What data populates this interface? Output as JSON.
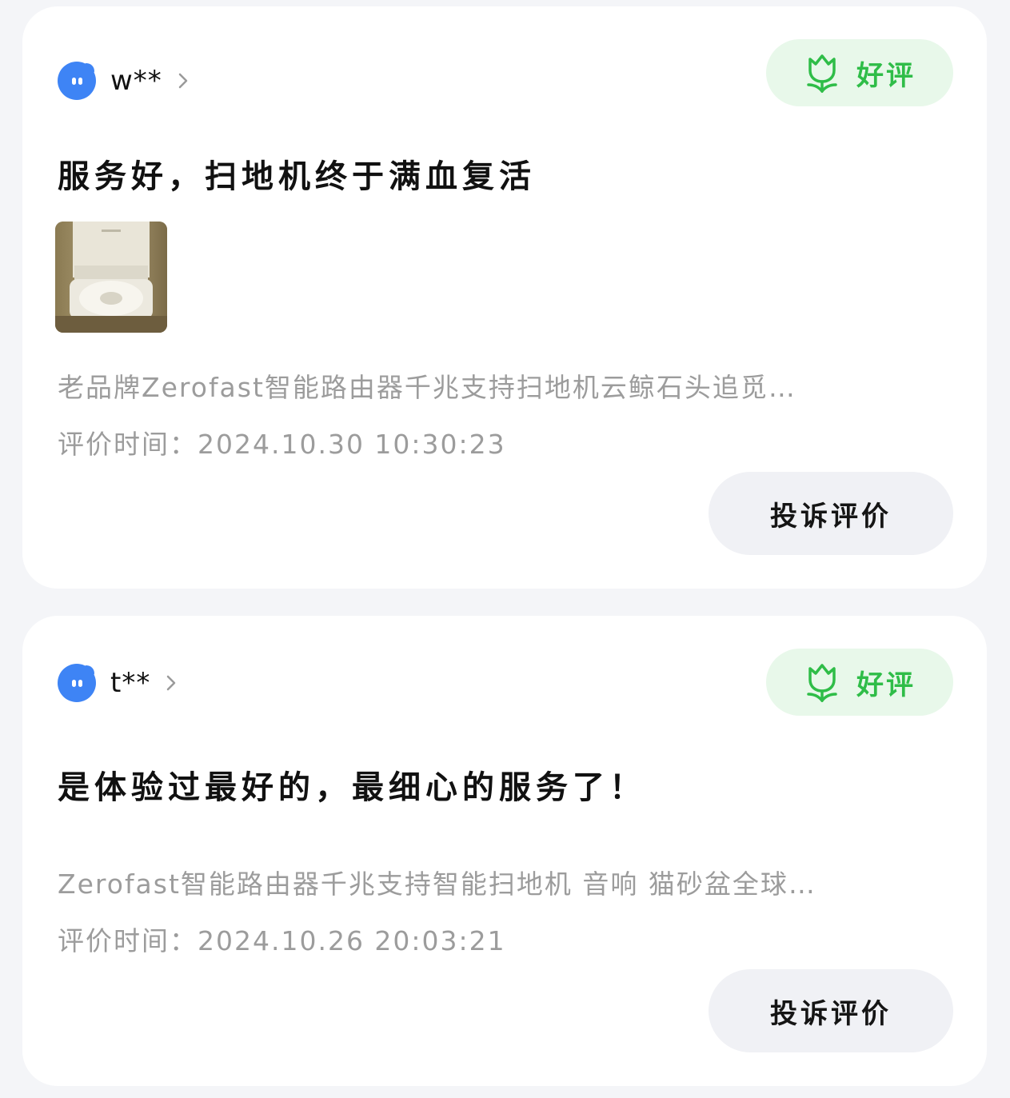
{
  "reviews": [
    {
      "username": "w**",
      "badge_label": "好评",
      "title": "服务好，扫地机终于满血复活",
      "has_photo": true,
      "product": "老品牌Zerofast智能路由器千兆支持扫地机云鲸石头追觅…",
      "time_prefix": "评价时间：",
      "time_value": "2024.10.30 10:30:23",
      "complain_label": "投诉评价"
    },
    {
      "username": "t**",
      "badge_label": "好评",
      "title": "是体验过最好的，最细心的服务了！",
      "has_photo": false,
      "product": "Zerofast智能路由器千兆支持智能扫地机 音响 猫砂盆全球…",
      "time_prefix": "评价时间：",
      "time_value": "2024.10.26 20:03:21",
      "complain_label": "投诉评价"
    }
  ],
  "colors": {
    "page_bg": "#f4f5f8",
    "card_bg": "#ffffff",
    "avatar_blue": "#3e84f5",
    "badge_bg": "#e8f8ea",
    "badge_green": "#2fbd48",
    "secondary_text": "#9c9c9c",
    "button_bg": "#f0f1f5"
  },
  "icons": {
    "avatar": "blue-chat-bubble-avatar",
    "chevron": "chevron-right-icon",
    "badge": "tulip-icon"
  }
}
